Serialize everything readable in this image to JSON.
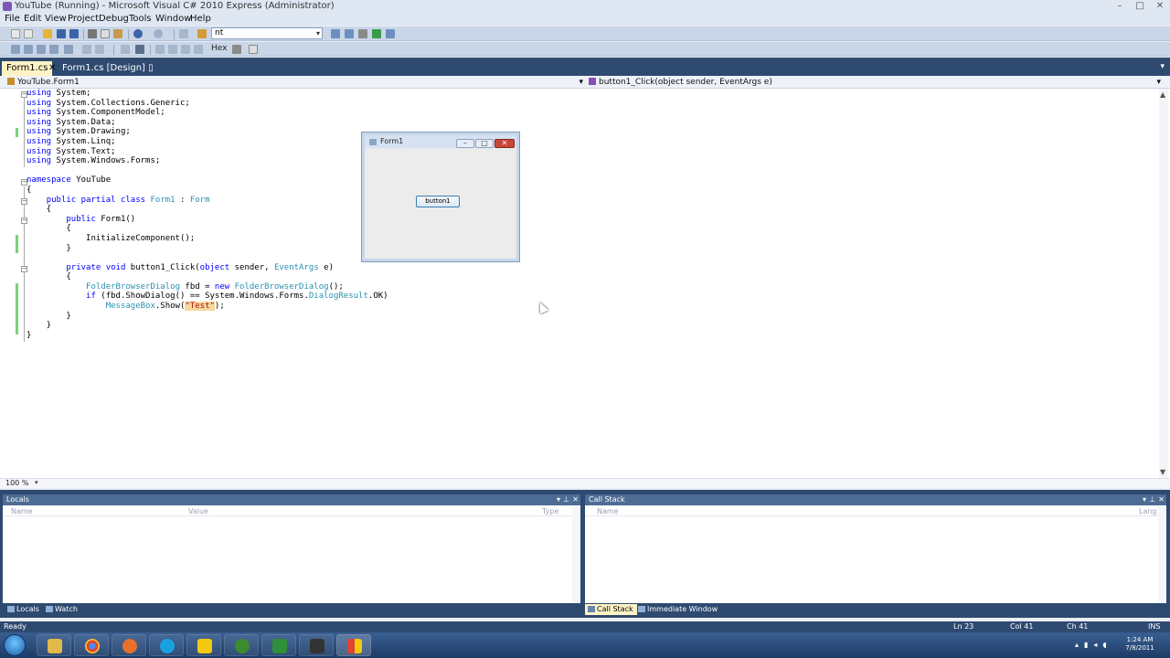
{
  "window": {
    "title": "YouTube (Running) - Microsoft Visual C# 2010 Express (Administrator)"
  },
  "menu": [
    "File",
    "Edit",
    "View",
    "Project",
    "Debug",
    "Tools",
    "Window",
    "Help"
  ],
  "toolbar": {
    "solution_combo_value": "nt",
    "hex_label": "Hex"
  },
  "tabs": [
    {
      "label": "Form1.cs",
      "active": true
    },
    {
      "label": "Form1.cs [Design]",
      "active": false
    }
  ],
  "nav": {
    "class_combo": "YouTube.Form1",
    "member_combo": "button1_Click(object sender, EventArgs e)"
  },
  "code_lines": [
    "using System;",
    "using System.Collections.Generic;",
    "using System.ComponentModel;",
    "using System.Data;",
    "using System.Drawing;",
    "using System.Linq;",
    "using System.Text;",
    "using System.Windows.Forms;",
    "",
    "namespace YouTube",
    "{",
    "    public partial class Form1 : Form",
    "    {",
    "        public Form1()",
    "        {",
    "            InitializeComponent();",
    "        }",
    "",
    "        private void button1_Click(object sender, EventArgs e)",
    "        {",
    "            FolderBrowserDialog fbd = new FolderBrowserDialog();",
    "            if (fbd.ShowDialog() == System.Windows.Forms.DialogResult.OK)",
    "                MessageBox.Show(\"Test\");",
    "        }",
    "    }",
    "}"
  ],
  "form_window": {
    "title": "Form1",
    "button_label": "button1"
  },
  "zoom": "100 %",
  "locals_panel": {
    "title": "Locals",
    "columns": [
      "Name",
      "Value",
      "Type"
    ]
  },
  "callstack_panel": {
    "title": "Call Stack",
    "columns": [
      "Name",
      "Lang"
    ]
  },
  "left_tabs": [
    {
      "label": "Locals",
      "active": true
    },
    {
      "label": "Watch",
      "active": false
    }
  ],
  "right_tabs": [
    {
      "label": "Call Stack",
      "active": true
    },
    {
      "label": "Immediate Window",
      "active": false
    }
  ],
  "status": {
    "text": "Ready",
    "ln": "Ln 23",
    "col": "Col 41",
    "ch": "Ch 41",
    "mode": "INS"
  },
  "clock": {
    "time": "1:24 AM",
    "date": "7/8/2011"
  },
  "colors": {
    "accent": "#2e4a70",
    "active_tab": "#fff3c4",
    "keyword": "#0000ff",
    "type": "#2b91af",
    "string": "#a31515"
  }
}
